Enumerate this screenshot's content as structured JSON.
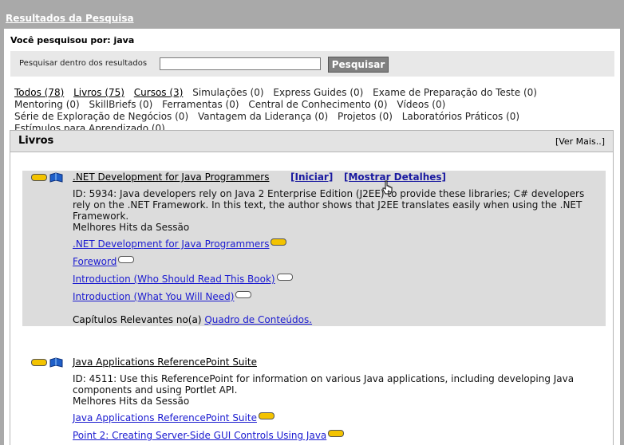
{
  "header": {
    "title": "Resultados da Pesquisa"
  },
  "search": {
    "query_line": "Você pesquisou por: java",
    "within_label": "Pesquisar dentro dos resultados",
    "input_value": "",
    "button_label": "Pesquisar"
  },
  "categories": [
    {
      "label": "Todos (78)",
      "link": true
    },
    {
      "label": "Livros (75)",
      "link": true
    },
    {
      "label": "Cursos (3)",
      "link": true
    },
    {
      "label": "Simulações (0)",
      "link": false
    },
    {
      "label": "Express Guides (0)",
      "link": false
    },
    {
      "label": "Exame de Preparação do Teste (0)",
      "link": false
    },
    {
      "label": "Mentoring (0)",
      "link": false
    },
    {
      "label": "SkillBriefs (0)",
      "link": false
    },
    {
      "label": "Ferramentas (0)",
      "link": false
    },
    {
      "label": "Central de Conhecimento (0)",
      "link": false
    },
    {
      "label": "Vídeos (0)",
      "link": false
    },
    {
      "label": "Série de Exploração de Negócios (0)",
      "link": false
    },
    {
      "label": "Vantagem da Liderança (0)",
      "link": false
    },
    {
      "label": "Projetos (0)",
      "link": false
    },
    {
      "label": "Laboratórios Práticos (0)",
      "link": false
    },
    {
      "label": "Estímulos para Aprendizado (0)",
      "link": false
    }
  ],
  "section": {
    "title": "Livros",
    "more_label": "[Ver Mais..]"
  },
  "results": [
    {
      "title": ".NET Development for Java Programmers",
      "start_label": "[Iniciar]",
      "details_label": "[Mostrar Detalhes]",
      "description": "ID: 5934: Java developers rely on Java 2 Enterprise Edition (J2EE) to provide these libraries; C# developers rely on the .NET Framework. In this text, the author shows that J2EE translates easily when using the .NET Framework.",
      "hits_label": "Melhores Hits da Sessão",
      "sub_links": [
        ".NET Development for Java Programmers",
        "Foreword",
        "Introduction (Who Should Read This Book)",
        "Introduction (What You Will Need)"
      ],
      "chapters_prefix": "Capítulos Relevantes no(a)",
      "chapters_link": "Quadro de Conteúdos."
    },
    {
      "title": "Java Applications ReferencePoint Suite",
      "description": "ID: 4511: Use this ReferencePoint for information on various Java applications, including developing Java components and using Portlet API.",
      "hits_label": "Melhores Hits da Sessão",
      "sub_links": [
        "Java Applications ReferencePoint Suite",
        "Point 2: Creating Server-Side GUI Controls Using Java"
      ]
    }
  ],
  "colors": {
    "accent_link": "#1a1ad0",
    "rating_fill": "#f3c300",
    "frame_gray": "#a9a9a9"
  }
}
